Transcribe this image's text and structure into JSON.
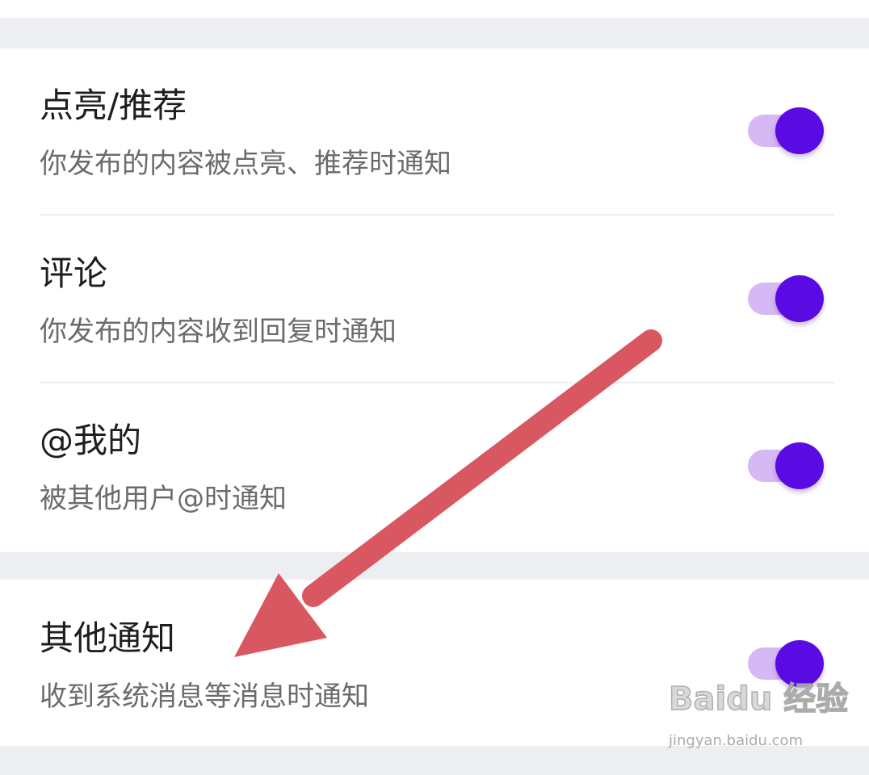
{
  "settings": {
    "items": [
      {
        "title": "点亮/推荐",
        "description": "你发布的内容被点亮、推荐时通知",
        "enabled": true
      },
      {
        "title": "评论",
        "description": "你发布的内容收到回复时通知",
        "enabled": true
      },
      {
        "title": "@我的",
        "description": "被其他用户@时通知",
        "enabled": true
      },
      {
        "title": "其他通知",
        "description": "收到系统消息等消息时通知",
        "enabled": true
      }
    ]
  },
  "annotation": {
    "arrow_color": "#d95760"
  },
  "watermark": {
    "logo": "Baidu 经验",
    "url": "jingyan.baidu.com"
  },
  "colors": {
    "toggle_on_thumb": "#5a0be3",
    "toggle_on_track": "#d5b8f4",
    "section_gap": "#eceef2"
  }
}
